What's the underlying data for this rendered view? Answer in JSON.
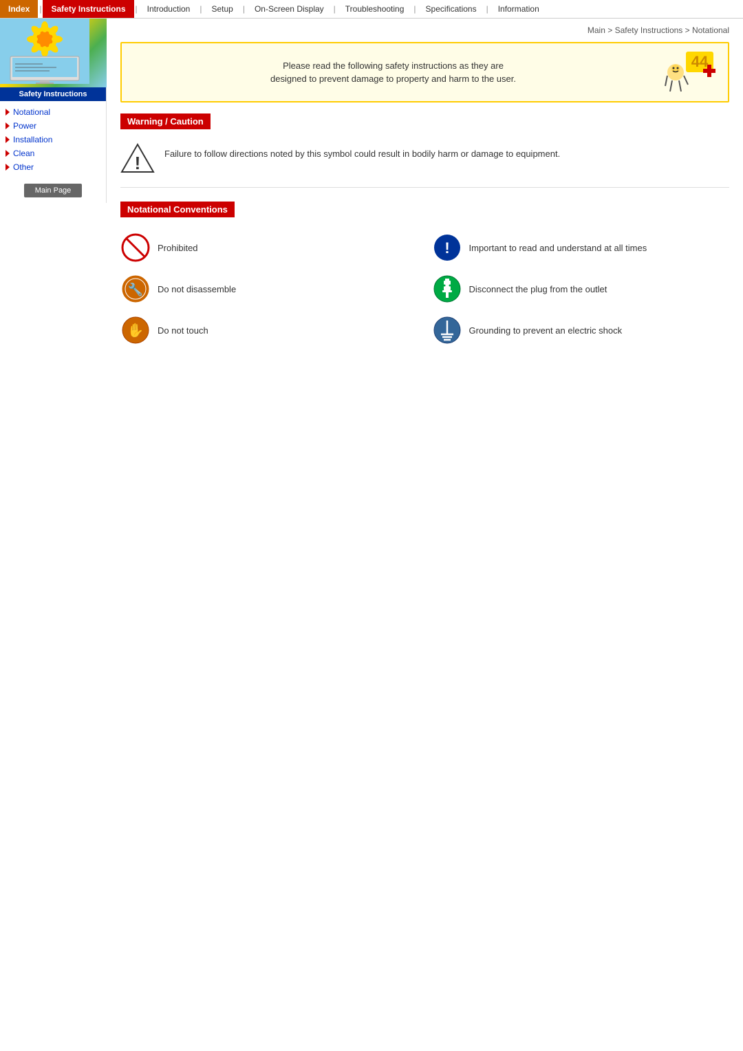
{
  "nav": {
    "items": [
      {
        "label": "Index",
        "type": "index"
      },
      {
        "label": "Safety Instructions",
        "type": "active"
      },
      {
        "label": "Introduction",
        "type": "normal"
      },
      {
        "label": "Setup",
        "type": "normal"
      },
      {
        "label": "On-Screen Display",
        "type": "normal"
      },
      {
        "label": "Troubleshooting",
        "type": "normal"
      },
      {
        "label": "Specifications",
        "type": "normal"
      },
      {
        "label": "Information",
        "type": "normal"
      }
    ]
  },
  "sidebar": {
    "label": "Safety Instructions",
    "menu": [
      {
        "label": "Notational"
      },
      {
        "label": "Power"
      },
      {
        "label": "Installation"
      },
      {
        "label": "Clean"
      },
      {
        "label": "Other"
      }
    ],
    "main_page_btn": "Main Page"
  },
  "breadcrumb": "Main > Safety Instructions > Notational",
  "intro": {
    "text_line1": "Please read the following safety instructions as they are",
    "text_line2": "designed to prevent damage to property and harm to the user."
  },
  "warning": {
    "header": "Warning / Caution",
    "text": "Failure to follow directions noted by this symbol could result in bodily harm or damage to equipment."
  },
  "notational": {
    "header": "Notational Conventions",
    "items": [
      {
        "icon": "prohibited",
        "label": "Prohibited"
      },
      {
        "icon": "important",
        "label": "Important to read and understand at all times"
      },
      {
        "icon": "no-disassemble",
        "label": "Do not disassemble"
      },
      {
        "icon": "disconnect",
        "label": "Disconnect the plug from the outlet"
      },
      {
        "icon": "no-touch",
        "label": "Do not touch"
      },
      {
        "icon": "grounding",
        "label": "Grounding to prevent an electric shock"
      }
    ]
  }
}
